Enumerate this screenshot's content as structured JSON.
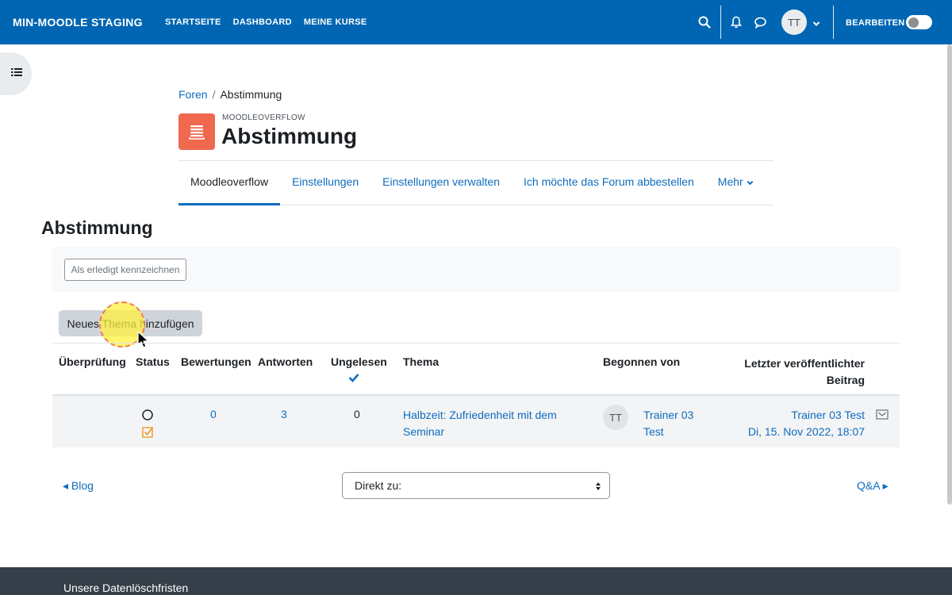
{
  "navbar": {
    "brand": "MIN-MOODLE STAGING",
    "links": [
      "STARTSEITE",
      "DASHBOARD",
      "MEINE KURSE"
    ],
    "user_initials": "TT",
    "edit_label": "BEARBEITEN",
    "bg_color": "#0066b3"
  },
  "breadcrumb": {
    "parent": "Foren",
    "separator": "/",
    "current": "Abstimmung"
  },
  "header": {
    "module_label": "MOODLEOVERFLOW",
    "title": "Abstimmung",
    "icon_color": "#f0694f"
  },
  "secondary_nav": {
    "tabs": [
      "Moodleoverflow",
      "Einstellungen",
      "Einstellungen verwalten",
      "Ich möchte das Forum abbestellen"
    ],
    "more_label": "Mehr"
  },
  "main": {
    "section_title": "Abstimmung",
    "mark_done_label": "Als erledigt kennzeichnen",
    "new_topic_label": "Neues Thema hinzufügen"
  },
  "table": {
    "headers": {
      "review": "Überprüfung",
      "status": "Status",
      "ratings": "Bewertungen",
      "replies": "Antworten",
      "unread": "Ungelesen",
      "topic": "Thema",
      "started_by": "Begonnen von",
      "last_post_line1": "Letzter veröffentlichter",
      "last_post_line2": "Beitrag"
    },
    "row": {
      "ratings": "0",
      "replies": "3",
      "unread": "0",
      "topic_line1": "Halbzeit: Zufriedenheit mit dem",
      "topic_line2": "Seminar",
      "author_initials": "TT",
      "author_line1": "Trainer 03",
      "author_line2": "Test",
      "last_post_author": "Trainer 03 Test",
      "last_post_date": "Di, 15. Nov 2022, 18:07"
    }
  },
  "pager": {
    "prev": "◂ Blog",
    "jump_placeholder": "Direkt zu:",
    "next": "Q&A ▸"
  },
  "footer": {
    "link": "Unsere Datenlöschfristen"
  }
}
